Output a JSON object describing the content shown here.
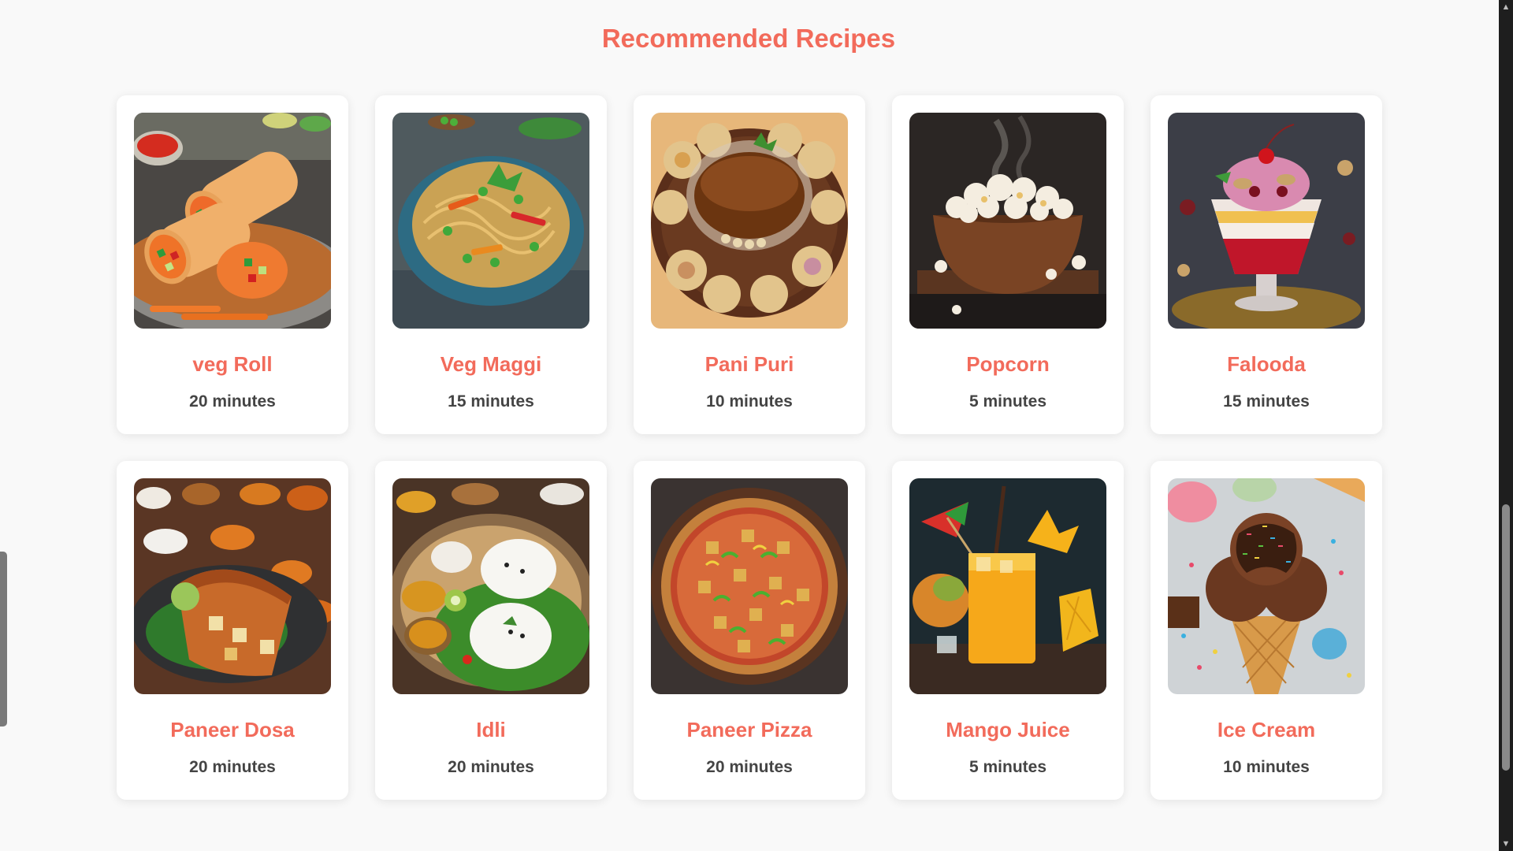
{
  "header": {
    "title": "Recommended Recipes"
  },
  "accent_color": "#f26b5b",
  "recipes": [
    {
      "name": "veg Roll",
      "time": "20 minutes",
      "image": "veg-roll"
    },
    {
      "name": "Veg Maggi",
      "time": "15 minutes",
      "image": "veg-maggi"
    },
    {
      "name": "Pani Puri",
      "time": "10 minutes",
      "image": "pani-puri"
    },
    {
      "name": "Popcorn",
      "time": "5 minutes",
      "image": "popcorn"
    },
    {
      "name": "Falooda",
      "time": "15 minutes",
      "image": "falooda"
    },
    {
      "name": "Paneer Dosa",
      "time": "20 minutes",
      "image": "paneer-dosa"
    },
    {
      "name": "Idli",
      "time": "20 minutes",
      "image": "idli"
    },
    {
      "name": "Paneer Pizza",
      "time": "20 minutes",
      "image": "paneer-pizza"
    },
    {
      "name": "Mango Juice",
      "time": "5 minutes",
      "image": "mango-juice"
    },
    {
      "name": "Ice Cream",
      "time": "10 minutes",
      "image": "ice-cream"
    }
  ],
  "scrollbar": {
    "up_icon": "arrow-up-icon",
    "down_icon": "arrow-down-icon"
  }
}
